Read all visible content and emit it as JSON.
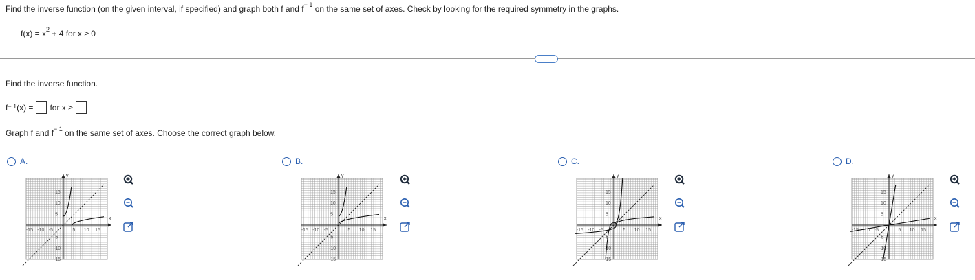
{
  "question": {
    "prompt_before_sup": "Find the inverse function (on the given interval, if specified) and graph both f and f",
    "prompt_sup": "− 1",
    "prompt_after_sup": " on the same set of axes. Check by looking for the required symmetry in the graphs.",
    "function_left": "f(x) = x",
    "function_exp": "2",
    "function_right": " + 4 for x ≥ 0"
  },
  "divider": {
    "ellipsis": "⋯"
  },
  "part1": {
    "instruction": "Find the inverse function.",
    "answer_prefix": "f",
    "answer_sup": "− 1",
    "answer_mid": "(x) =",
    "answer_for": "for x ≥"
  },
  "part2": {
    "instruction_before": "Graph f and f",
    "instruction_sup": "− 1",
    "instruction_after": " on the same set of axes. Choose the correct graph below."
  },
  "options": [
    {
      "label": "A."
    },
    {
      "label": "B."
    },
    {
      "label": "C."
    },
    {
      "label": "D."
    }
  ],
  "graph_labels": {
    "x_axis": "x",
    "y_axis": "y",
    "ticks_pos": [
      "5",
      "10",
      "15"
    ],
    "ticks_neg": [
      "-15",
      "-10",
      "-5"
    ]
  },
  "tool_icons": [
    "zoom-in-icon",
    "zoom-out-icon",
    "open-new-window-icon"
  ],
  "colors": {
    "accent": "#2a5fb0",
    "grid": "#9a9a9a",
    "curve": "#111111"
  }
}
